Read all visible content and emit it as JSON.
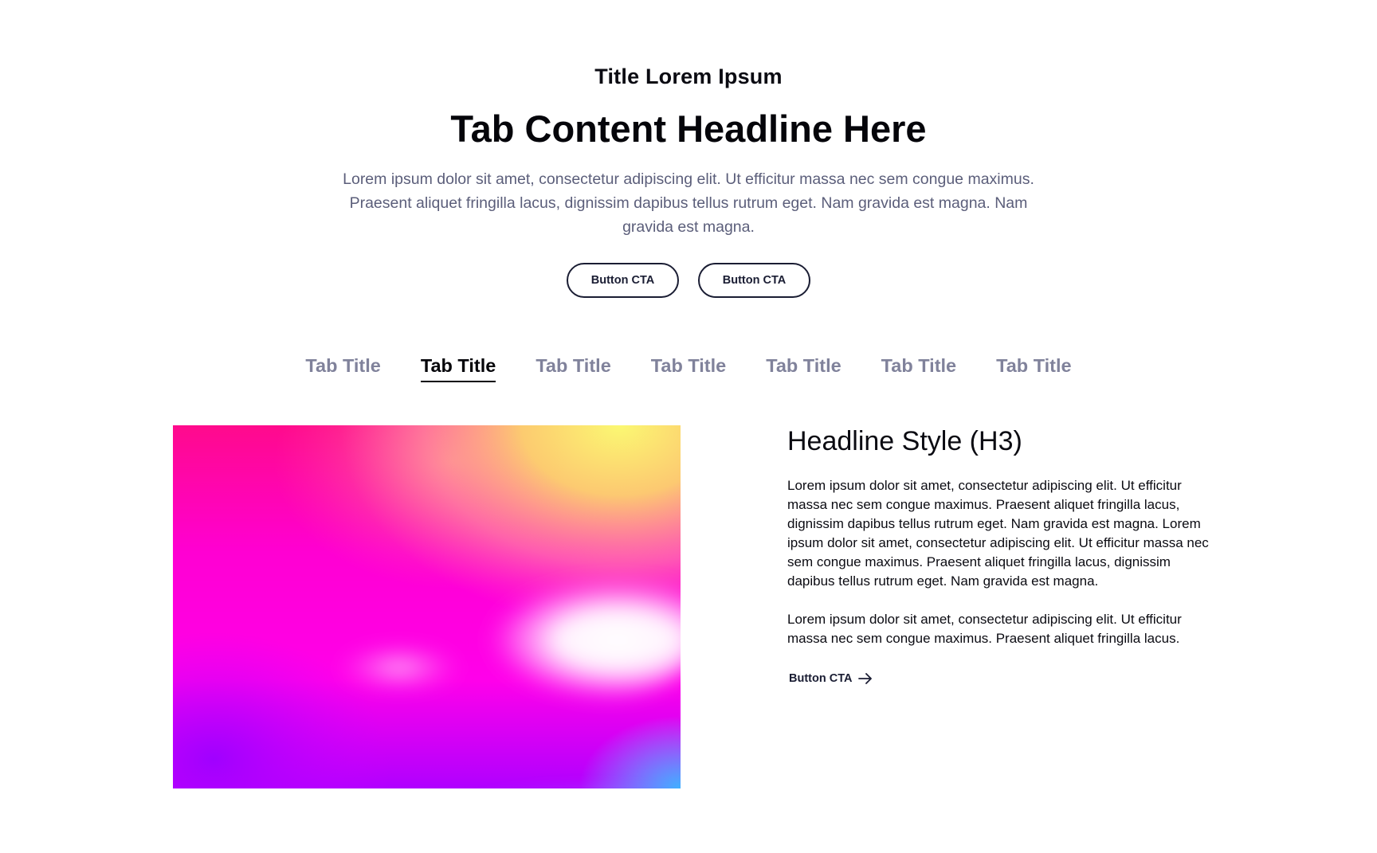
{
  "intro": {
    "eyebrow": "Title Lorem Ipsum",
    "headline": "Tab Content Headline Here",
    "lede": "Lorem ipsum dolor sit amet, consectetur adipiscing elit. Ut efficitur massa nec sem congue maximus. Praesent aliquet fringilla lacus, dignissim dapibus tellus rutrum eget. Nam gravida est magna. Nam gravida est magna.",
    "cta_primary": "Button CTA",
    "cta_secondary": "Button CTA"
  },
  "tabs": [
    {
      "label": "Tab Title",
      "active": false
    },
    {
      "label": "Tab Title",
      "active": true
    },
    {
      "label": "Tab Title",
      "active": false
    },
    {
      "label": "Tab Title",
      "active": false
    },
    {
      "label": "Tab Title",
      "active": false
    },
    {
      "label": "Tab Title",
      "active": false
    },
    {
      "label": "Tab Title",
      "active": false
    }
  ],
  "panel": {
    "h3": "Headline Style (H3)",
    "paragraph_1": "Lorem ipsum dolor sit amet, consectetur adipiscing elit. Ut efficitur massa nec sem congue maximus. Praesent aliquet fringilla lacus, dignissim dapibus tellus rutrum eget. Nam gravida est magna. Lorem ipsum dolor sit amet, consectetur adipiscing elit. Ut efficitur massa nec sem congue maximus. Praesent aliquet fringilla lacus, dignissim dapibus tellus rutrum eget. Nam gravida est magna.",
    "paragraph_2": "Lorem ipsum dolor sit amet, consectetur adipiscing elit. Ut efficitur massa nec sem congue maximus. Praesent aliquet fringilla lacus.",
    "link_cta": "Button CTA",
    "link_icon": "arrow-right-icon"
  },
  "colors": {
    "text": "#0b0b12",
    "muted": "#5b5e7a",
    "tab_inactive": "#80829b",
    "button_border": "#1a1d33",
    "gradient_pink": "#ff0a8c",
    "gradient_magenta": "#ff00ea",
    "gradient_yellow": "#fbf872",
    "gradient_violet": "#a400ff",
    "gradient_cyan": "#5ff8f0",
    "gradient_blue": "#3fb0ff"
  }
}
